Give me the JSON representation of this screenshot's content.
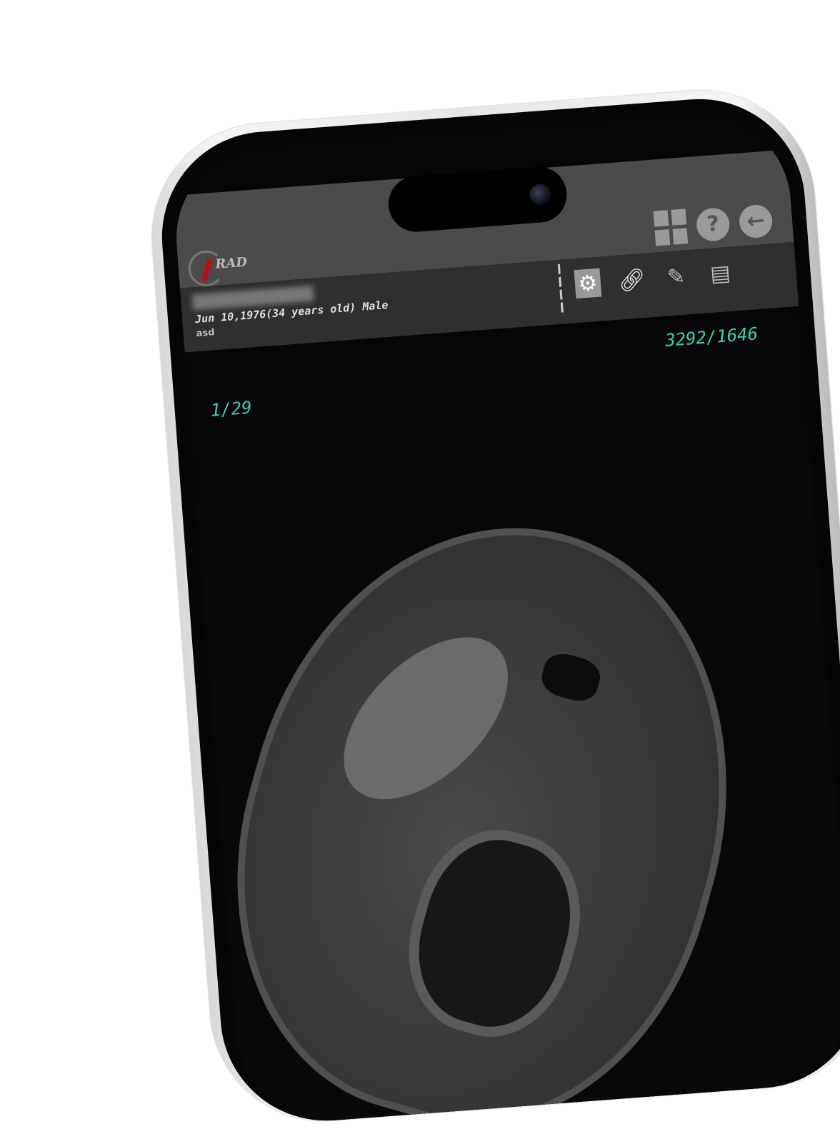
{
  "app": {
    "logo_text": "RAD"
  },
  "topbar": {
    "icons": [
      "grid-icon",
      "help-icon",
      "back-arrow-icon"
    ]
  },
  "patient": {
    "dob_line": "Jun 10,1976(34 years old) Male",
    "note": "asd"
  },
  "tools": {
    "icons": [
      "settings-icon",
      "link-icon",
      "edit-icon",
      "document-icon"
    ]
  },
  "viewer": {
    "window_level": "3292/1646",
    "image_index": "1/29"
  },
  "colors": {
    "accent": "#3fcfa8",
    "brand": "#b3121b"
  }
}
